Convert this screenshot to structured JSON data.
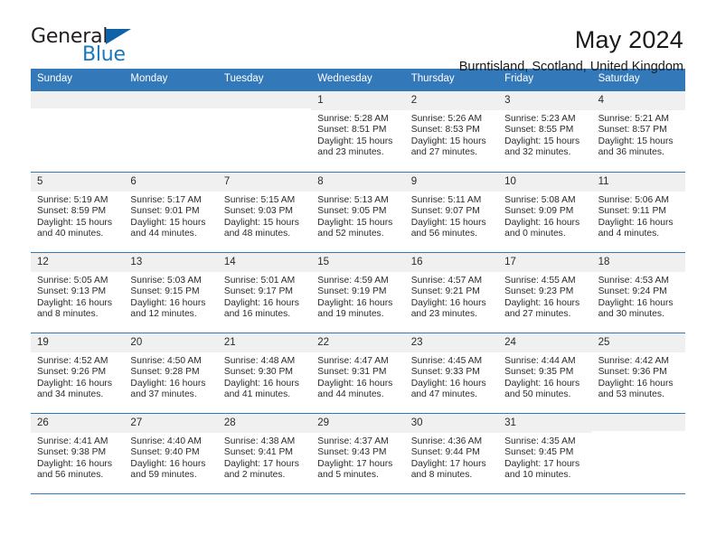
{
  "brand": {
    "name_part1": "General",
    "name_part2": "Blue",
    "triangle_color": "#0e63a8",
    "blue_color": "#1878be"
  },
  "header": {
    "title": "May 2024",
    "subtitle": "Burntisland, Scotland, United Kingdom",
    "header_bg": "#3379b9",
    "day_strip_bg": "#f0f0f0"
  },
  "weekdays": [
    "Sunday",
    "Monday",
    "Tuesday",
    "Wednesday",
    "Thursday",
    "Friday",
    "Saturday"
  ],
  "weeks": [
    [
      {
        "day": "",
        "sunrise": "",
        "sunset": "",
        "daylight": "",
        "empty": true
      },
      {
        "day": "",
        "sunrise": "",
        "sunset": "",
        "daylight": "",
        "empty": true
      },
      {
        "day": "",
        "sunrise": "",
        "sunset": "",
        "daylight": "",
        "empty": true
      },
      {
        "day": "1",
        "sunrise": "Sunrise: 5:28 AM",
        "sunset": "Sunset: 8:51 PM",
        "daylight": "Daylight: 15 hours and 23 minutes.",
        "empty": false
      },
      {
        "day": "2",
        "sunrise": "Sunrise: 5:26 AM",
        "sunset": "Sunset: 8:53 PM",
        "daylight": "Daylight: 15 hours and 27 minutes.",
        "empty": false
      },
      {
        "day": "3",
        "sunrise": "Sunrise: 5:23 AM",
        "sunset": "Sunset: 8:55 PM",
        "daylight": "Daylight: 15 hours and 32 minutes.",
        "empty": false
      },
      {
        "day": "4",
        "sunrise": "Sunrise: 5:21 AM",
        "sunset": "Sunset: 8:57 PM",
        "daylight": "Daylight: 15 hours and 36 minutes.",
        "empty": false
      }
    ],
    [
      {
        "day": "5",
        "sunrise": "Sunrise: 5:19 AM",
        "sunset": "Sunset: 8:59 PM",
        "daylight": "Daylight: 15 hours and 40 minutes.",
        "empty": false
      },
      {
        "day": "6",
        "sunrise": "Sunrise: 5:17 AM",
        "sunset": "Sunset: 9:01 PM",
        "daylight": "Daylight: 15 hours and 44 minutes.",
        "empty": false
      },
      {
        "day": "7",
        "sunrise": "Sunrise: 5:15 AM",
        "sunset": "Sunset: 9:03 PM",
        "daylight": "Daylight: 15 hours and 48 minutes.",
        "empty": false
      },
      {
        "day": "8",
        "sunrise": "Sunrise: 5:13 AM",
        "sunset": "Sunset: 9:05 PM",
        "daylight": "Daylight: 15 hours and 52 minutes.",
        "empty": false
      },
      {
        "day": "9",
        "sunrise": "Sunrise: 5:11 AM",
        "sunset": "Sunset: 9:07 PM",
        "daylight": "Daylight: 15 hours and 56 minutes.",
        "empty": false
      },
      {
        "day": "10",
        "sunrise": "Sunrise: 5:08 AM",
        "sunset": "Sunset: 9:09 PM",
        "daylight": "Daylight: 16 hours and 0 minutes.",
        "empty": false
      },
      {
        "day": "11",
        "sunrise": "Sunrise: 5:06 AM",
        "sunset": "Sunset: 9:11 PM",
        "daylight": "Daylight: 16 hours and 4 minutes.",
        "empty": false
      }
    ],
    [
      {
        "day": "12",
        "sunrise": "Sunrise: 5:05 AM",
        "sunset": "Sunset: 9:13 PM",
        "daylight": "Daylight: 16 hours and 8 minutes.",
        "empty": false
      },
      {
        "day": "13",
        "sunrise": "Sunrise: 5:03 AM",
        "sunset": "Sunset: 9:15 PM",
        "daylight": "Daylight: 16 hours and 12 minutes.",
        "empty": false
      },
      {
        "day": "14",
        "sunrise": "Sunrise: 5:01 AM",
        "sunset": "Sunset: 9:17 PM",
        "daylight": "Daylight: 16 hours and 16 minutes.",
        "empty": false
      },
      {
        "day": "15",
        "sunrise": "Sunrise: 4:59 AM",
        "sunset": "Sunset: 9:19 PM",
        "daylight": "Daylight: 16 hours and 19 minutes.",
        "empty": false
      },
      {
        "day": "16",
        "sunrise": "Sunrise: 4:57 AM",
        "sunset": "Sunset: 9:21 PM",
        "daylight": "Daylight: 16 hours and 23 minutes.",
        "empty": false
      },
      {
        "day": "17",
        "sunrise": "Sunrise: 4:55 AM",
        "sunset": "Sunset: 9:23 PM",
        "daylight": "Daylight: 16 hours and 27 minutes.",
        "empty": false
      },
      {
        "day": "18",
        "sunrise": "Sunrise: 4:53 AM",
        "sunset": "Sunset: 9:24 PM",
        "daylight": "Daylight: 16 hours and 30 minutes.",
        "empty": false
      }
    ],
    [
      {
        "day": "19",
        "sunrise": "Sunrise: 4:52 AM",
        "sunset": "Sunset: 9:26 PM",
        "daylight": "Daylight: 16 hours and 34 minutes.",
        "empty": false
      },
      {
        "day": "20",
        "sunrise": "Sunrise: 4:50 AM",
        "sunset": "Sunset: 9:28 PM",
        "daylight": "Daylight: 16 hours and 37 minutes.",
        "empty": false
      },
      {
        "day": "21",
        "sunrise": "Sunrise: 4:48 AM",
        "sunset": "Sunset: 9:30 PM",
        "daylight": "Daylight: 16 hours and 41 minutes.",
        "empty": false
      },
      {
        "day": "22",
        "sunrise": "Sunrise: 4:47 AM",
        "sunset": "Sunset: 9:31 PM",
        "daylight": "Daylight: 16 hours and 44 minutes.",
        "empty": false
      },
      {
        "day": "23",
        "sunrise": "Sunrise: 4:45 AM",
        "sunset": "Sunset: 9:33 PM",
        "daylight": "Daylight: 16 hours and 47 minutes.",
        "empty": false
      },
      {
        "day": "24",
        "sunrise": "Sunrise: 4:44 AM",
        "sunset": "Sunset: 9:35 PM",
        "daylight": "Daylight: 16 hours and 50 minutes.",
        "empty": false
      },
      {
        "day": "25",
        "sunrise": "Sunrise: 4:42 AM",
        "sunset": "Sunset: 9:36 PM",
        "daylight": "Daylight: 16 hours and 53 minutes.",
        "empty": false
      }
    ],
    [
      {
        "day": "26",
        "sunrise": "Sunrise: 4:41 AM",
        "sunset": "Sunset: 9:38 PM",
        "daylight": "Daylight: 16 hours and 56 minutes.",
        "empty": false
      },
      {
        "day": "27",
        "sunrise": "Sunrise: 4:40 AM",
        "sunset": "Sunset: 9:40 PM",
        "daylight": "Daylight: 16 hours and 59 minutes.",
        "empty": false
      },
      {
        "day": "28",
        "sunrise": "Sunrise: 4:38 AM",
        "sunset": "Sunset: 9:41 PM",
        "daylight": "Daylight: 17 hours and 2 minutes.",
        "empty": false
      },
      {
        "day": "29",
        "sunrise": "Sunrise: 4:37 AM",
        "sunset": "Sunset: 9:43 PM",
        "daylight": "Daylight: 17 hours and 5 minutes.",
        "empty": false
      },
      {
        "day": "30",
        "sunrise": "Sunrise: 4:36 AM",
        "sunset": "Sunset: 9:44 PM",
        "daylight": "Daylight: 17 hours and 8 minutes.",
        "empty": false
      },
      {
        "day": "31",
        "sunrise": "Sunrise: 4:35 AM",
        "sunset": "Sunset: 9:45 PM",
        "daylight": "Daylight: 17 hours and 10 minutes.",
        "empty": false
      },
      {
        "day": "",
        "sunrise": "",
        "sunset": "",
        "daylight": "",
        "empty": true
      }
    ]
  ]
}
